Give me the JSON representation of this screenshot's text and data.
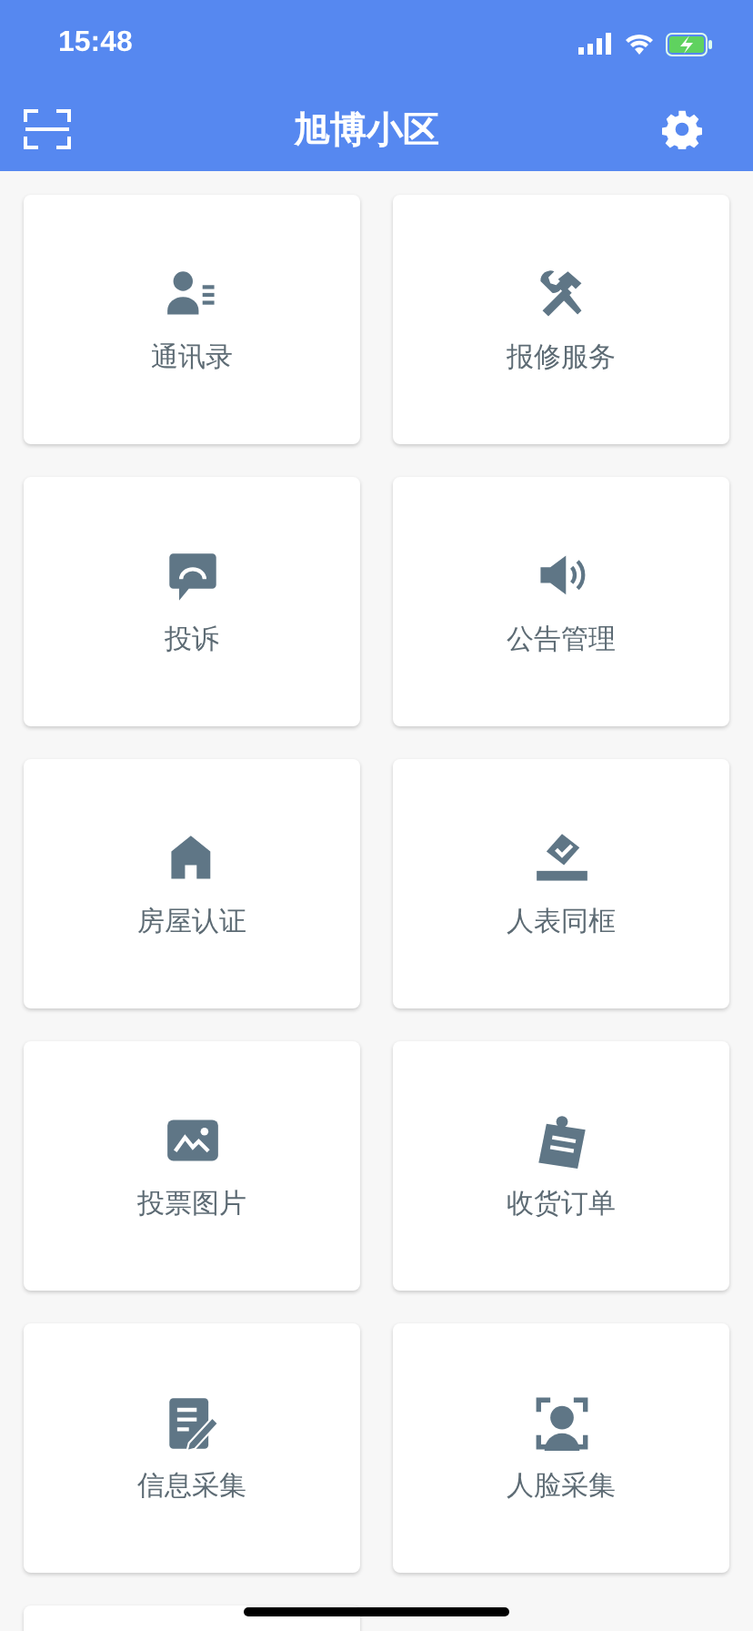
{
  "status_bar": {
    "time": "15:48"
  },
  "header": {
    "title": "旭博小区"
  },
  "tiles": [
    {
      "label": "通讯录"
    },
    {
      "label": "报修服务"
    },
    {
      "label": "投诉"
    },
    {
      "label": "公告管理"
    },
    {
      "label": "房屋认证"
    },
    {
      "label": "人表同框"
    },
    {
      "label": "投票图片"
    },
    {
      "label": "收货订单"
    },
    {
      "label": "信息采集"
    },
    {
      "label": "人脸采集"
    }
  ]
}
